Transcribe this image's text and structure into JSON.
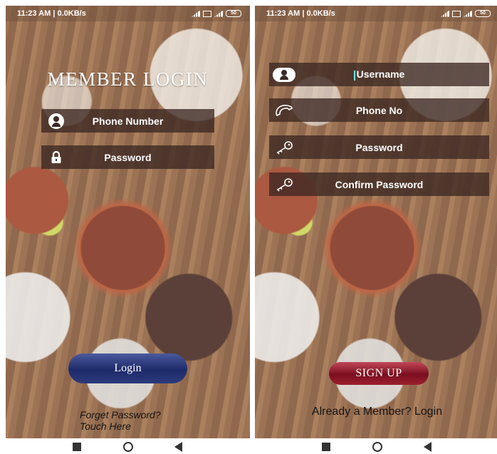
{
  "login_screen": {
    "status": {
      "time_data": "11:23 AM | 0.0KB/s",
      "battery": "50"
    },
    "title": "MEMBER LOGIN",
    "fields": {
      "phone_label": "Phone Number",
      "password_label": "Password"
    },
    "login_label": "Login",
    "forgot_line1": "Forget Password?",
    "forgot_line2": "Touch Here"
  },
  "signup_screen": {
    "status": {
      "time_data": "11:23 AM | 0.0KB/s",
      "battery": "50"
    },
    "fields": {
      "username_label": "Username",
      "phone_label": "Phone No",
      "password_label": "Password",
      "confirm_label": "Confirm Password"
    },
    "signup_label": "SIGN UP",
    "member_link": "Already a Member? Login"
  },
  "icons": {
    "user": "user-icon",
    "lock": "lock-icon",
    "phone": "phone-icon",
    "key": "key-icon"
  },
  "colors": {
    "field_bg": "#3c2823",
    "login_button": "#1d2a6a",
    "signup_button": "#7a0e1e"
  }
}
